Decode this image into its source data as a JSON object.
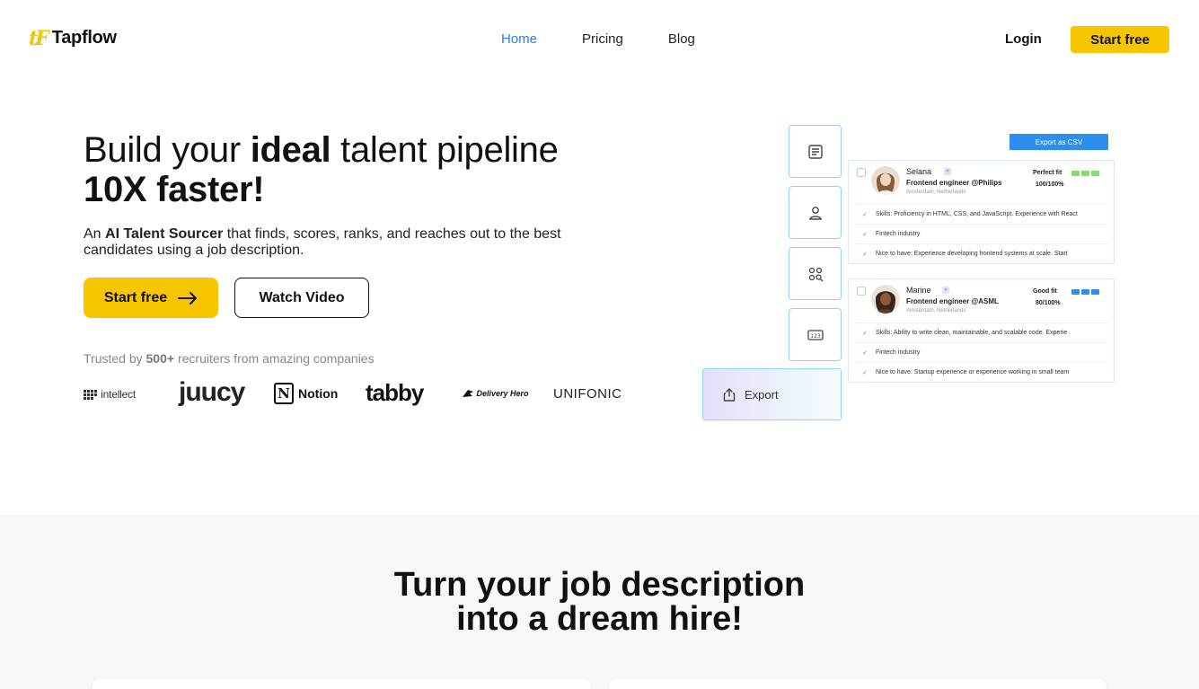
{
  "brand": {
    "mark": "tF",
    "name": "Tapflow",
    "accent": "#f7c600"
  },
  "nav": {
    "links": [
      {
        "label": "Home",
        "active": true
      },
      {
        "label": "Pricing",
        "active": false
      },
      {
        "label": "Blog",
        "active": false
      }
    ],
    "login": "Login",
    "cta": "Start free"
  },
  "hero": {
    "title_1a": "Build your ",
    "title_1b": "ideal",
    "title_1c": " talent pipeline",
    "title_2": "10X faster!",
    "sub_a": "An ",
    "sub_b": "AI Talent Sourcer",
    "sub_c": " that finds, scores, ranks, and reaches out to the best candidates using a job description.",
    "btn_start": "Start free",
    "btn_video": "Watch Video",
    "trusted_a": "Trusted by ",
    "trusted_b": "500+",
    "trusted_c": " recruiters from amazing companies",
    "companies": [
      "intellect",
      "juucy",
      "Notion",
      "tabby",
      "Delivery Hero",
      "UNIFONIC"
    ]
  },
  "mockup": {
    "side_icons": [
      "document-icon",
      "person-icon",
      "search-grid-icon",
      "number-icon"
    ],
    "export_label": "Export",
    "csv_button": "Export as CSV",
    "candidates": [
      {
        "name": "Selana",
        "role": "Frontend engineer @Philips",
        "location": "Amsterdam, Netherlands",
        "fit_label": "Perfect fit",
        "fit_score": "100/100%",
        "fit_color": "#7ee06b",
        "criteria": [
          "Skills: Proficiency in HTML, CSS, and JavaScript. Experience with React",
          "Fintech industry",
          "Nice to have: Experience developing frontend systems at scale. Start"
        ]
      },
      {
        "name": "Marine",
        "role": "Frontend engineer @ASML",
        "location": "Amsterdam, Netherlands",
        "fit_label": "Good fit",
        "fit_score": "80/100%",
        "fit_color": "#2b8ef0",
        "criteria": [
          "Skills: Ability to write clean, maintainable, and scalable code. Experie",
          "Fintech industry",
          "Nice to have: Startup experience or experience working in small team"
        ]
      }
    ]
  },
  "section2": {
    "title_1": "Turn your job description",
    "title_2": "into a dream hire!"
  }
}
